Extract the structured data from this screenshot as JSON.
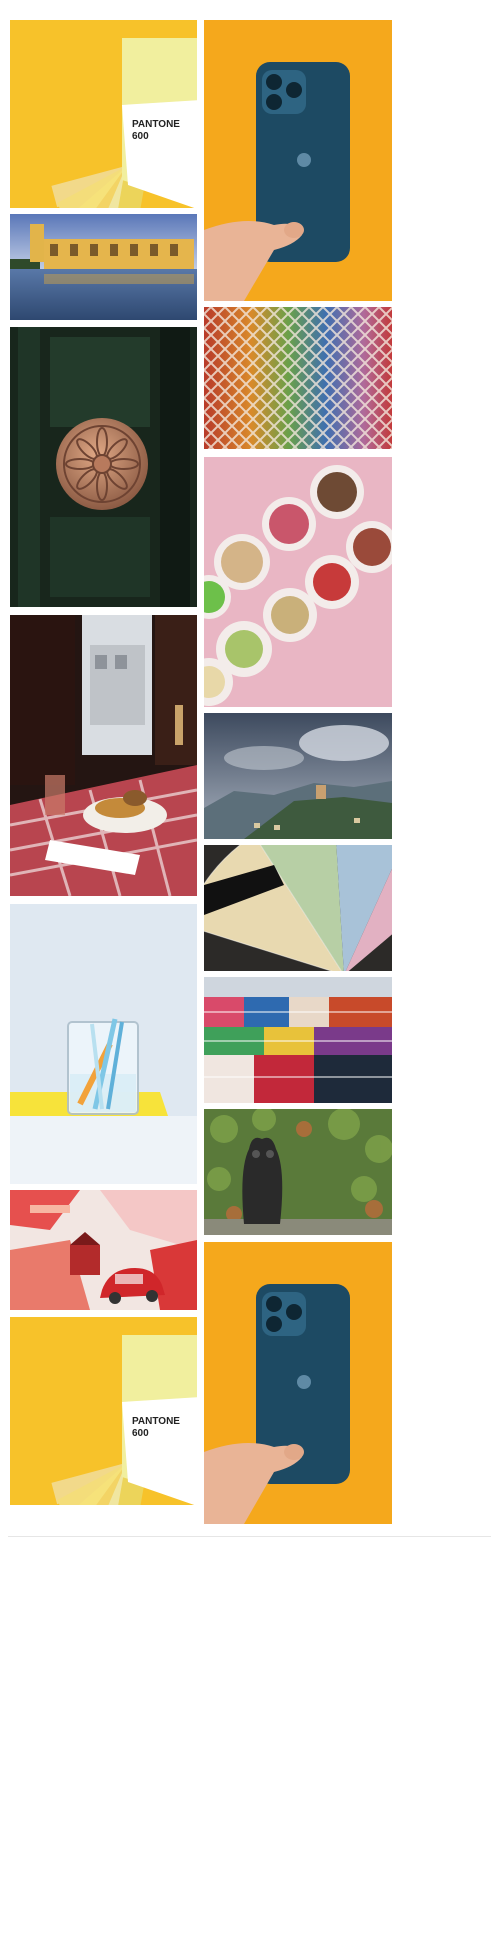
{
  "gallery": {
    "pantone_label": "PANTONE",
    "pantone_number": "600",
    "pantone_registered": "®",
    "palette": {
      "yellow": "#f7c22a",
      "orange": "#f5a81c",
      "phone_blue": "#1d4a63",
      "pink": "#e9b6c4",
      "sky": "#dfe7ef"
    },
    "tiles": [
      {
        "name": "pantone-swatch-photo",
        "icon": "color-swatch"
      },
      {
        "name": "blue-phone-in-hand-photo",
        "icon": "smartphone"
      },
      {
        "name": "yellow-lakeside-building-photo",
        "icon": "building"
      },
      {
        "name": "colorful-tiles-photo",
        "icon": "mosaic"
      },
      {
        "name": "ornate-door-knob-photo",
        "icon": "door-knob"
      },
      {
        "name": "bowls-on-pink-photo",
        "icon": "bowls"
      },
      {
        "name": "window-diner-meal-photo",
        "icon": "meal"
      },
      {
        "name": "cloudy-mountain-town-photo",
        "icon": "landscape"
      },
      {
        "name": "color-fan-deck-photo",
        "icon": "fan-deck"
      },
      {
        "name": "textile-market-photo",
        "icon": "textile"
      },
      {
        "name": "glass-beaker-photo",
        "icon": "beaker"
      },
      {
        "name": "owl-statue-photo",
        "icon": "owl"
      },
      {
        "name": "red-toy-car-photo",
        "icon": "toy-car"
      },
      {
        "name": "pantone-swatch-photo-repeat",
        "icon": "color-swatch"
      },
      {
        "name": "blue-phone-in-hand-photo-repeat",
        "icon": "smartphone"
      }
    ]
  }
}
